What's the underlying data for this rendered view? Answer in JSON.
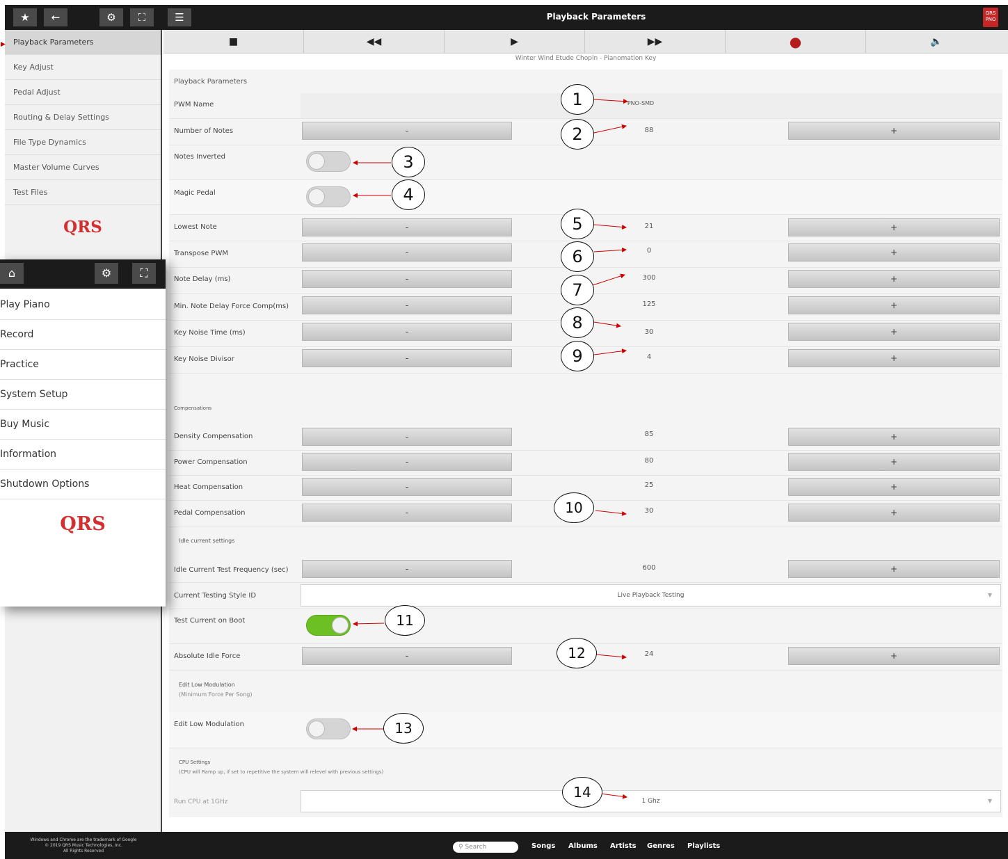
{
  "header": {
    "title": "Playback Parameters",
    "badge": "QRS PNO"
  },
  "sidebar": {
    "items": [
      {
        "label": "Playback Parameters"
      },
      {
        "label": "Key Adjust"
      },
      {
        "label": "Pedal Adjust"
      },
      {
        "label": "Routing & Delay Settings"
      },
      {
        "label": "File Type Dynamics"
      },
      {
        "label": "Master Volume Curves"
      },
      {
        "label": "Test Files"
      }
    ],
    "logo": "QRS"
  },
  "transport": {
    "now_playing": "Winter Wind Etude Chopin - Pianomation Key"
  },
  "main": {
    "title": "Playback Parameters",
    "pwm_name_label": "PWM Name",
    "pwm_name_value": "PNO-SMD",
    "rows": [
      {
        "label": "Number of Notes",
        "value": "88"
      },
      {
        "label": "Lowest Note",
        "value": "21"
      },
      {
        "label": "Transpose PWM",
        "value": "0"
      },
      {
        "label": "Note Delay (ms)",
        "value": "300"
      },
      {
        "label": "Min. Note Delay Force Comp(ms)",
        "value": "125"
      },
      {
        "label": "Key Noise Time (ms)",
        "value": "30"
      },
      {
        "label": "Key Noise Divisor",
        "value": "4"
      }
    ],
    "notes_inverted_label": "Notes Inverted",
    "magic_pedal_label": "Magic Pedal",
    "compensations_title": "Compensations",
    "compensations": [
      {
        "label": "Density Compensation",
        "value": "85"
      },
      {
        "label": "Power Compensation",
        "value": "80"
      },
      {
        "label": "Heat Compensation",
        "value": "25"
      },
      {
        "label": "Pedal Compensation",
        "value": "30"
      }
    ],
    "idle_title": "Idle current settings",
    "idle_freq_label": "Idle Current Test Frequency (sec)",
    "idle_freq_value": "600",
    "testing_style_label": "Current Testing Style ID",
    "testing_style_value": "Live Playback Testing",
    "test_boot_label": "Test Current on Boot",
    "abs_idle_label": "Absolute Idle Force",
    "abs_idle_value": "24",
    "low_mod_title": "Edit Low Modulation",
    "low_mod_sub": "(Minimum Force Per Song)",
    "low_mod_label": "Edit Low Modulation",
    "cpu_title": "CPU Settings",
    "cpu_sub": "(CPU will Ramp up, if set to repetitive the system will relevel with previous settings)",
    "cpu_label": "Run CPU at 1GHz",
    "cpu_value": "1 Ghz",
    "minus": "-",
    "plus": "+"
  },
  "toggles": {
    "notes_inverted": false,
    "magic_pedal": false,
    "test_on_boot": true,
    "low_modulation": false
  },
  "overlay": {
    "items": [
      {
        "label": "Play Piano"
      },
      {
        "label": "Record"
      },
      {
        "label": "Practice"
      },
      {
        "label": "System Setup"
      },
      {
        "label": "Buy Music"
      },
      {
        "label": "Information"
      },
      {
        "label": "Shutdown Options"
      }
    ],
    "logo": "QRS"
  },
  "footer": {
    "copyright_1": "Windows and Chrome are the trademark of Google",
    "copyright_2": "© 2019 QRS Music Technologies, Inc.",
    "copyright_3": "All Rights Reserved",
    "search_placeholder": "Search",
    "links": [
      "Songs",
      "Albums",
      "Artists",
      "Genres",
      "Playlists"
    ]
  },
  "callouts": [
    "1",
    "2",
    "3",
    "4",
    "5",
    "6",
    "7",
    "8",
    "9",
    "10",
    "11",
    "12",
    "13",
    "14"
  ],
  "colors": {
    "accent_red": "#d32f2f",
    "toggle_on": "#6cc024",
    "bar_dark": "#1b1b1b"
  }
}
